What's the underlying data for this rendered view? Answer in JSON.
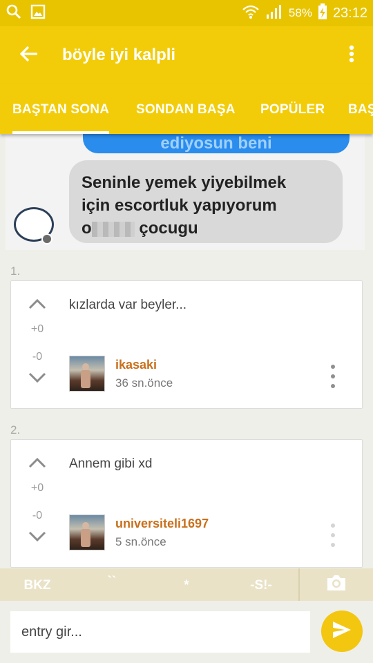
{
  "status_bar": {
    "battery": "58%",
    "time": "23:12",
    "icons": [
      "search-icon",
      "gallery-icon",
      "wifi-icon",
      "signal-icon",
      "battery-charging-icon"
    ]
  },
  "app_bar": {
    "title": "böyle iyi kalpli",
    "back_icon": "arrow-left-icon",
    "menu_icon": "more-vertical-icon"
  },
  "tabs": [
    {
      "label": "BAŞTAN SONA",
      "active": true
    },
    {
      "label": "SONDAN BAŞA",
      "active": false
    },
    {
      "label": "POPÜLER",
      "active": false
    },
    {
      "label": "BAŞ",
      "active": false
    }
  ],
  "topic_image": {
    "top_bubble_text": "ediyosun beni",
    "line1": "Seninle yemek yiyebilmek",
    "line2": "için escortluk yapıyorum",
    "line3_prefix": "o",
    "line3_suffix": "çocugu"
  },
  "entries": [
    {
      "number": "1.",
      "text": "kızlarda var beyler...",
      "votes_up": "+0",
      "votes_down": "-0",
      "author": "ikasaki",
      "time": "36 sn.önce"
    },
    {
      "number": "2.",
      "text": "Annem gibi xd",
      "votes_up": "+0",
      "votes_down": "-0",
      "author": "universiteli1697",
      "time": "5 sn.önce"
    }
  ],
  "shortcut_bar": {
    "bkz": "BKZ",
    "backtick": "``",
    "star": "*",
    "spoiler": "-S!-",
    "camera_icon": "camera-icon"
  },
  "composer": {
    "placeholder": "entry gir...",
    "send_icon": "send-icon"
  },
  "colors": {
    "accent": "#f2cc08",
    "author": "#c9701c"
  }
}
